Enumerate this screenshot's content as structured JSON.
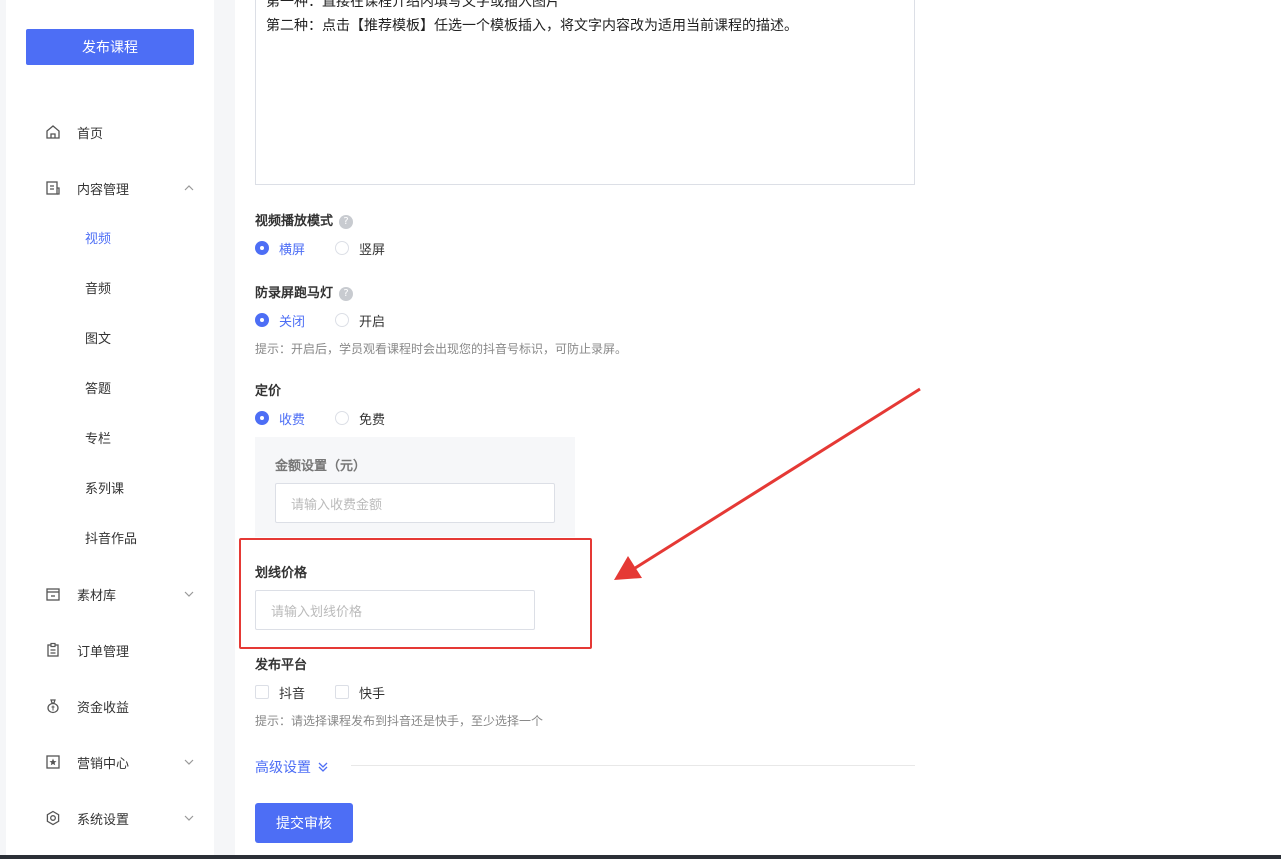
{
  "sidebar": {
    "publish_label": "发布课程",
    "items": [
      {
        "label": "首页",
        "icon": "home-icon"
      },
      {
        "label": "内容管理",
        "icon": "document-icon",
        "expanded": true
      },
      {
        "label": "素材库",
        "icon": "folder-icon"
      },
      {
        "label": "订单管理",
        "icon": "clipboard-icon"
      },
      {
        "label": "资金收益",
        "icon": "money-bag-icon"
      },
      {
        "label": "营销中心",
        "icon": "star-badge-icon"
      },
      {
        "label": "系统设置",
        "icon": "gear-icon"
      }
    ],
    "sub_items": [
      "视频",
      "音频",
      "图文",
      "答题",
      "专栏",
      "系列课",
      "抖音作品"
    ],
    "active_sub": "视频"
  },
  "editor": {
    "line1": "第一种：直接在课程介绍内填写文字或插入图片",
    "line2": "第二种：点击【推荐模板】任选一个模板插入，将文字内容改为适用当前课程的描述。"
  },
  "video_mode": {
    "label": "视频播放模式",
    "help": "?",
    "options": [
      "横屏",
      "竖屏"
    ],
    "selected": "横屏"
  },
  "marquee": {
    "label": "防录屏跑马灯",
    "help": "?",
    "options": [
      "关闭",
      "开启"
    ],
    "selected": "关闭",
    "hint": "提示：开启后，学员观看课程时会出现您的抖音号标识，可防止录屏。"
  },
  "pricing": {
    "label": "定价",
    "options": [
      "收费",
      "免费"
    ],
    "selected": "收费",
    "amount_label": "金额设置（元）",
    "amount_placeholder": "请输入收费金额"
  },
  "strike_price": {
    "label": "划线价格",
    "placeholder": "请输入划线价格"
  },
  "platform": {
    "label": "发布平台",
    "options": [
      "抖音",
      "快手"
    ],
    "hint": "提示：请选择课程发布到抖音还是快手，至少选择一个"
  },
  "advanced": {
    "label": "高级设置"
  },
  "submit_label": "提交审核",
  "colors": {
    "accent": "#4d6ef5",
    "highlight": "#e53935"
  }
}
